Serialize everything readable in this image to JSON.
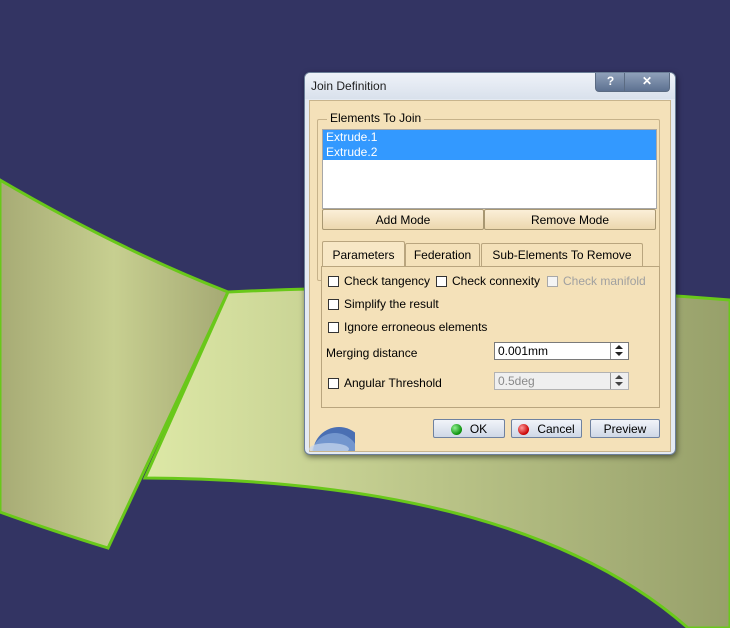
{
  "window": {
    "title": "Join Definition",
    "help_label": "?"
  },
  "elements_group": {
    "label": "Elements To Join",
    "items": [
      "Extrude.1",
      "Extrude.2"
    ],
    "add_mode_label": "Add Mode",
    "remove_mode_label": "Remove Mode"
  },
  "tabs": [
    "Parameters",
    "Federation",
    "Sub-Elements To Remove"
  ],
  "parameters": {
    "check_tangency": "Check tangency",
    "check_connexity": "Check connexity",
    "check_manifold": "Check manifold",
    "simplify": "Simplify the result",
    "ignore_erroneous": "Ignore erroneous elements",
    "merging_distance_label": "Merging distance",
    "merging_distance_value": "0.001mm",
    "angular_threshold_label": "Angular Threshold",
    "angular_threshold_value": "0.5deg"
  },
  "buttons": {
    "ok": "OK",
    "cancel": "Cancel",
    "preview": "Preview"
  },
  "colors": {
    "background": "#333463",
    "surface": "#d0da99",
    "edge": "#6fd01a",
    "selection": "#3399ff"
  }
}
